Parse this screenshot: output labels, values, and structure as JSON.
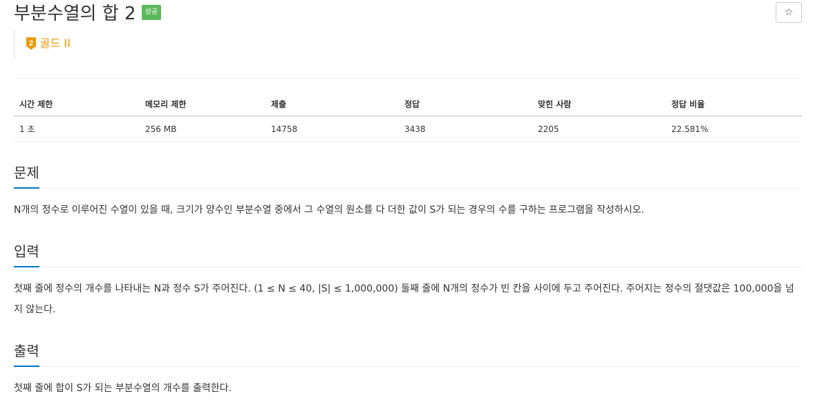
{
  "problem": {
    "title": "부분수열의 합 2",
    "status_badge": "성공",
    "star_icon": "☆",
    "tier": {
      "label": "골드 II",
      "level": "2",
      "color": "#ec9a00"
    }
  },
  "info_table": {
    "headers": [
      "시간 제한",
      "메모리 제한",
      "제출",
      "정답",
      "맞힌 사람",
      "정답 비율"
    ],
    "values": [
      "1 초",
      "256 MB",
      "14758",
      "3438",
      "2205",
      "22.581%"
    ]
  },
  "sections": {
    "description": {
      "title": "문제",
      "body": "N개의 정수로 이루어진 수열이 있을 때, 크기가 양수인 부분수열 중에서 그 수열의 원소를 다 더한 값이 S가 되는 경우의 수를 구하는 프로그램을 작성하시오."
    },
    "input": {
      "title": "입력",
      "body": "첫째 줄에 정수의 개수를 나타내는 N과 정수 S가 주어진다. (1 ≤ N ≤ 40, |S| ≤ 1,000,000) 둘째 줄에 N개의 정수가 빈 칸을 사이에 두고 주어진다. 주어지는 정수의 절댓값은 100,000을 넘지 않는다."
    },
    "output": {
      "title": "출력",
      "body": "첫째 줄에 합이 S가 되는 부분수열의 개수를 출력한다."
    }
  },
  "colors": {
    "badge_success": "#5cb85c",
    "section_underline": "#0076c0",
    "tier_gold": "#ec9a00"
  }
}
